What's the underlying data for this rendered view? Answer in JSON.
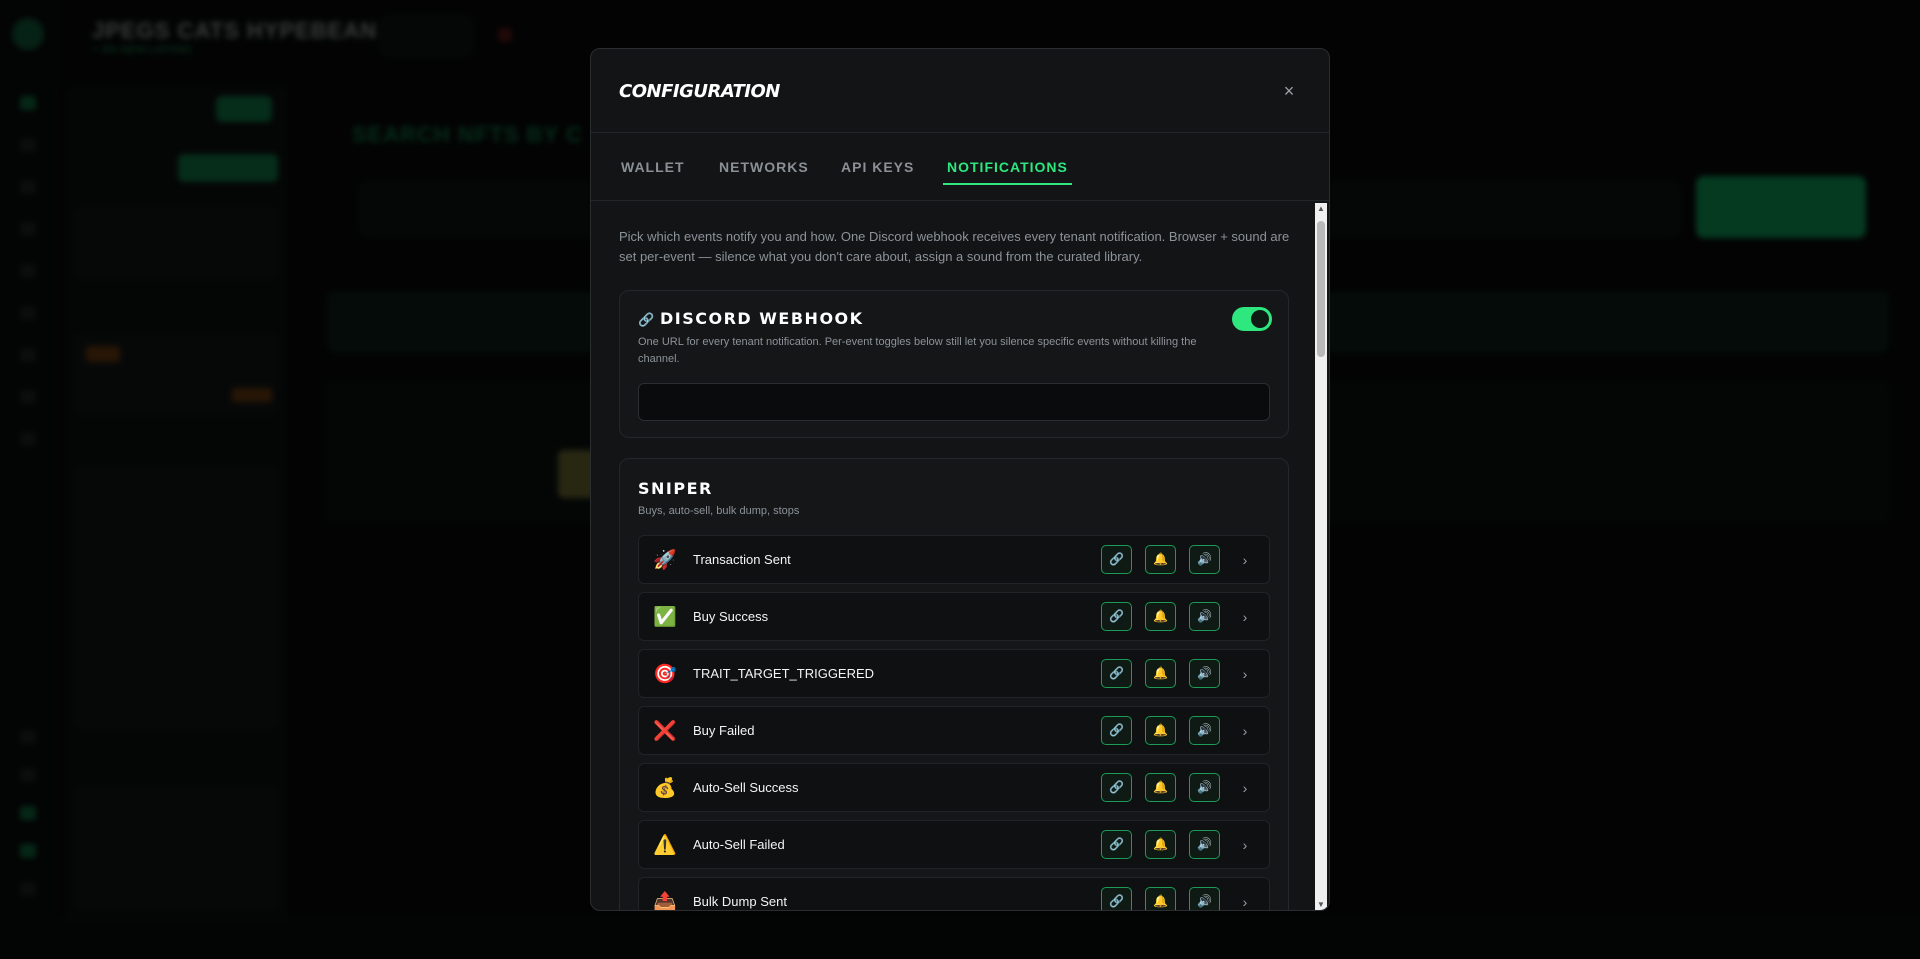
{
  "background": {
    "header_title": "JPEGS CATS HYPEBEAN",
    "header_sub": "+ 3% NEW LISTING",
    "main_title": "SEARCH NFTS BY C"
  },
  "modal": {
    "title": "CONFIGURATION",
    "close_label": "×",
    "tabs": [
      {
        "label": "WALLET",
        "active": false
      },
      {
        "label": "NETWORKS",
        "active": false
      },
      {
        "label": "API KEYS",
        "active": false
      },
      {
        "label": "NOTIFICATIONS",
        "active": true
      }
    ],
    "intro": "Pick which events notify you and how. One Discord webhook receives every tenant notification. Browser + sound are set per-event — silence what you don't care about, assign a sound from the curated library.",
    "webhook": {
      "title": "DISCORD WEBHOOK",
      "description": "One URL for every tenant notification. Per-event toggles below still let you silence specific events without killing the channel.",
      "enabled": true,
      "url_value": "",
      "url_placeholder": ""
    },
    "sniper": {
      "title": "SNIPER",
      "subtitle": "Buys, auto-sell, bulk dump, stops",
      "events": [
        {
          "emoji": "🚀",
          "label": "Transaction Sent"
        },
        {
          "emoji": "✅",
          "label": "Buy Success"
        },
        {
          "emoji": "🎯",
          "label": "TRAIT_TARGET_TRIGGERED"
        },
        {
          "emoji": "❌",
          "label": "Buy Failed"
        },
        {
          "emoji": "💰",
          "label": "Auto-Sell Success"
        },
        {
          "emoji": "⚠️",
          "label": "Auto-Sell Failed"
        },
        {
          "emoji": "📤",
          "label": "Bulk Dump Sent"
        }
      ]
    },
    "icons": {
      "link": "🔗",
      "bell": "🔔",
      "sound": "🔊",
      "chevron": "›"
    }
  },
  "colors": {
    "accent": "#2ee87f",
    "modal_bg": "#121416",
    "card_bg": "#141618"
  }
}
